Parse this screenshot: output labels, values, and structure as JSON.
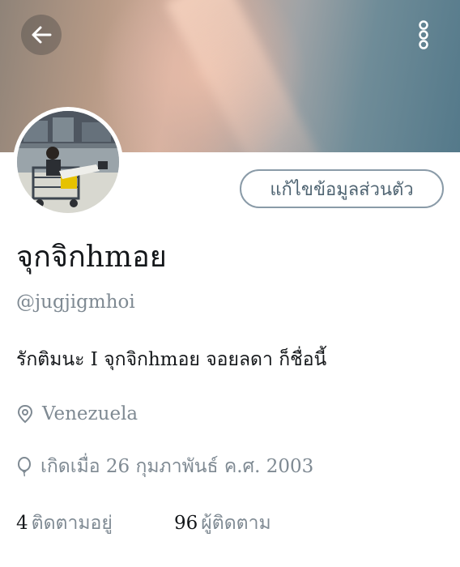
{
  "profile": {
    "display_name": "จุกจิกhmอย",
    "handle": "@jugjigmhoi",
    "bio": "รักติมนะ I จุกจิกhmอย จอยลดา ก็ชื่อนี้",
    "location": "Venezuela",
    "birth": "เกิดเมื่อ 26 กุมภาพันธ์ ค.ศ. 2003",
    "edit_label": "แก้ไขข้อมูลส่วนตัว"
  },
  "stats": {
    "following_count": "4",
    "following_label": "ติดตามอยู่",
    "followers_count": "96",
    "followers_label": "ผู้ติดตาม"
  },
  "icons": {
    "back": "arrow-left-icon",
    "more": "more-vertical-icon",
    "location": "location-pin-icon",
    "birth": "balloon-icon"
  },
  "colors": {
    "accent_outline": "#8a9ba8",
    "secondary_text": "#7f8a93",
    "primary_text": "#14171a"
  }
}
